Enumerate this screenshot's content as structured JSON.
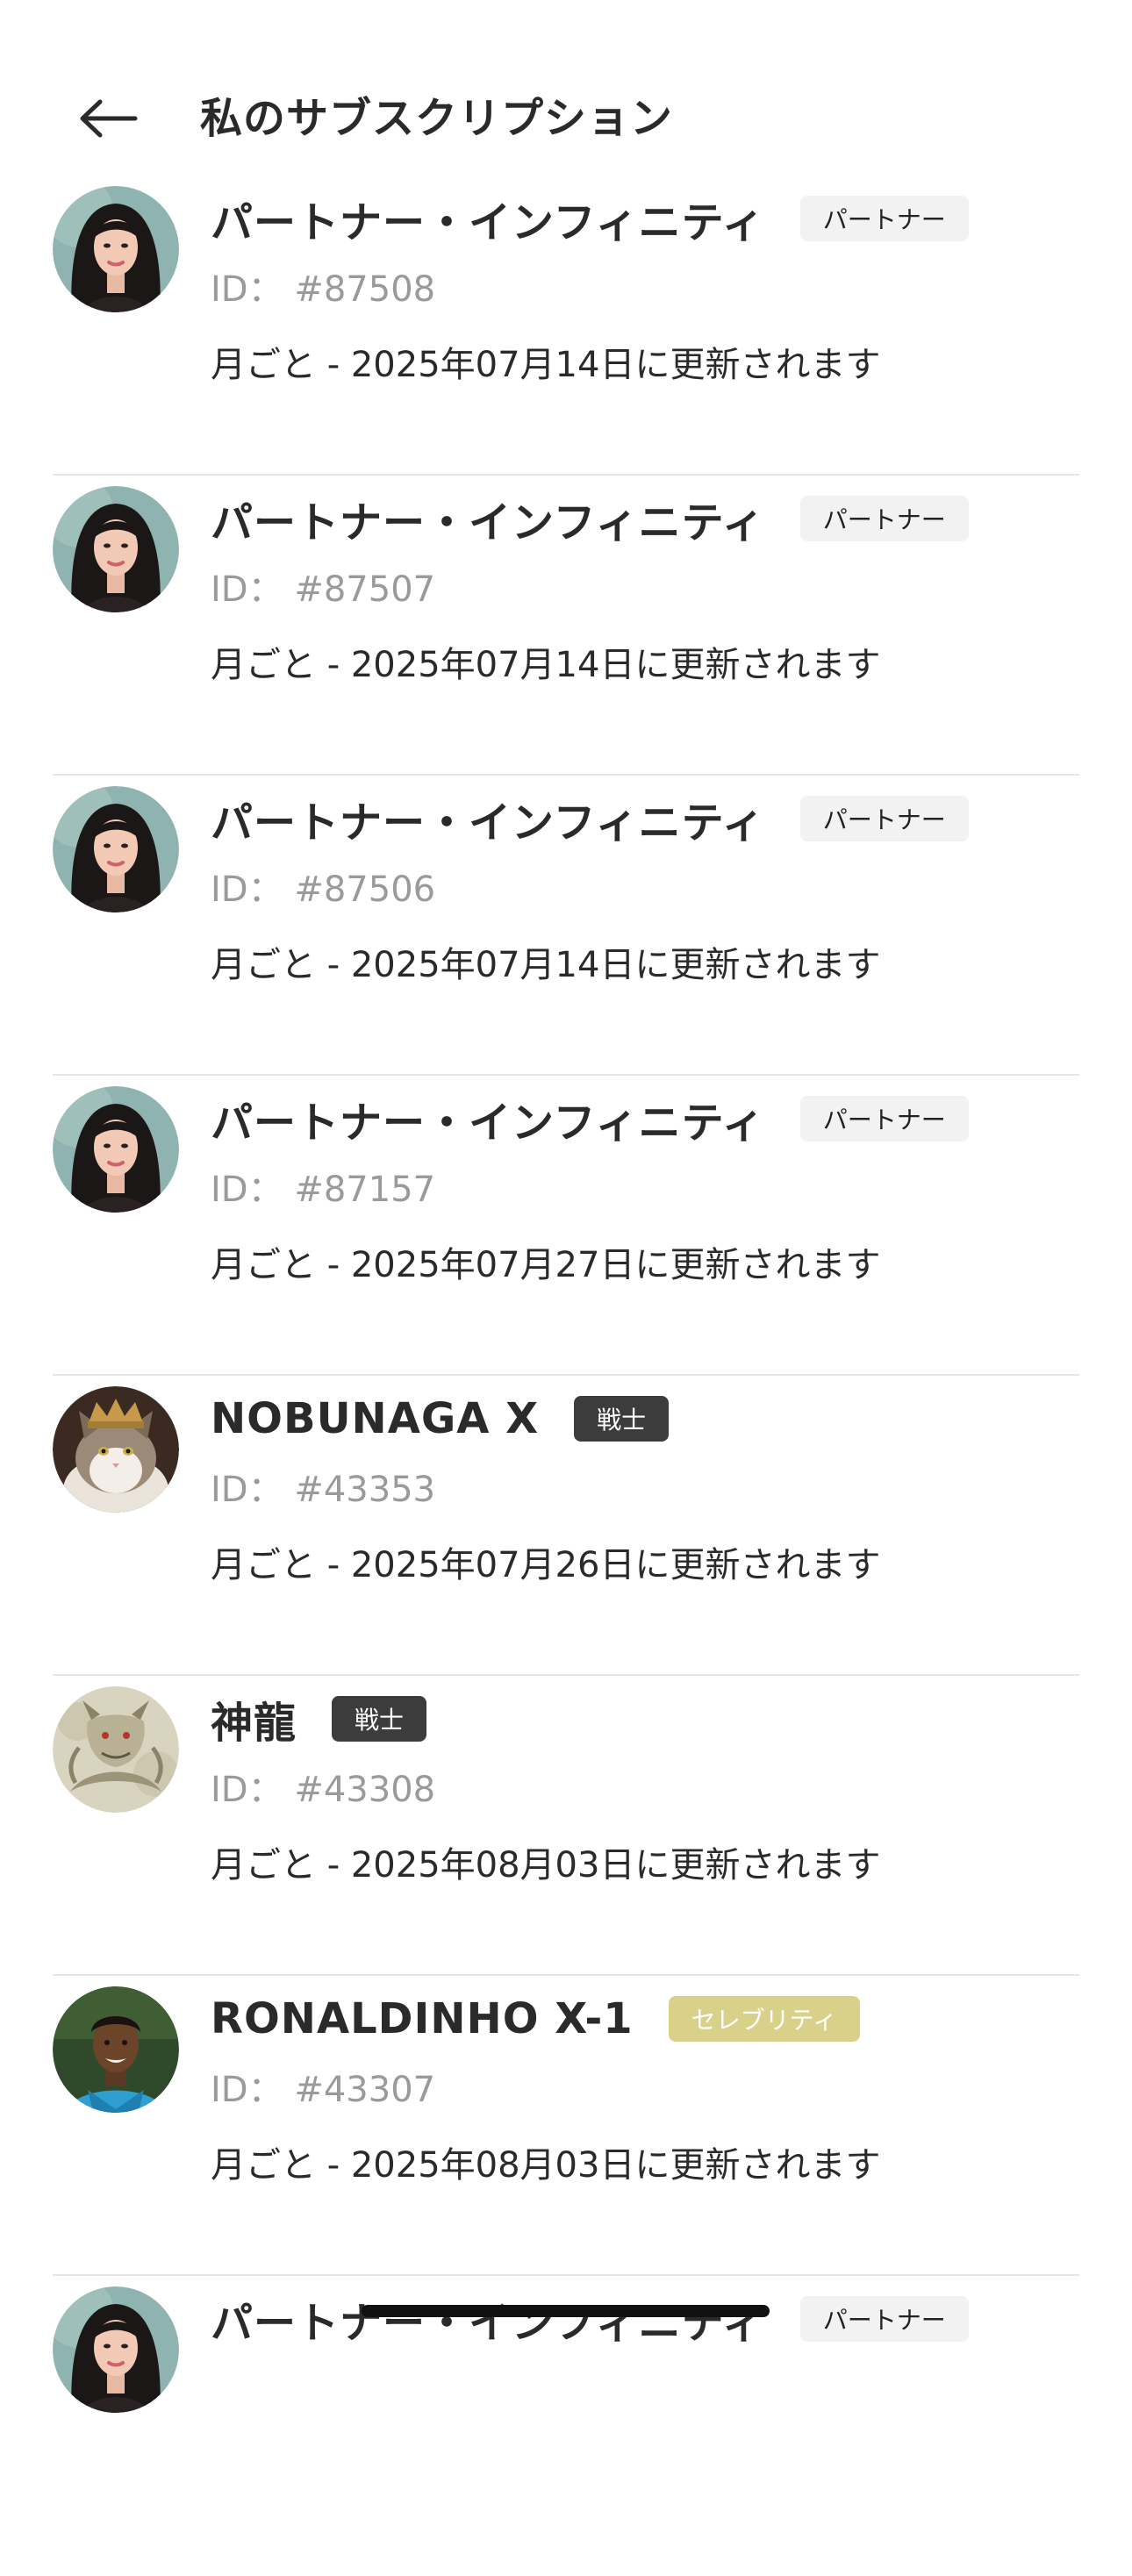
{
  "header": {
    "title": "私のサブスクリプション",
    "back_icon": "arrow-left-icon"
  },
  "colors": {
    "badge_partner_bg": "#f2f2f2",
    "badge_warrior_bg": "#3c3c3c",
    "badge_celebrity_bg": "#d9d18a",
    "divider": "#e6e6e6"
  },
  "subscriptions": [
    {
      "name": "パートナー・インフィニティ",
      "badge": "パートナー",
      "badge_type": "partner",
      "id_label": "ID：",
      "id_value": "#87508",
      "renewal": "月ごと - 2025年07月14日に更新されます",
      "avatar": "woman-portrait"
    },
    {
      "name": "パートナー・インフィニティ",
      "badge": "パートナー",
      "badge_type": "partner",
      "id_label": "ID：",
      "id_value": "#87507",
      "renewal": "月ごと - 2025年07月14日に更新されます",
      "avatar": "woman-portrait"
    },
    {
      "name": "パートナー・インフィニティ",
      "badge": "パートナー",
      "badge_type": "partner",
      "id_label": "ID：",
      "id_value": "#87506",
      "renewal": "月ごと - 2025年07月14日に更新されます",
      "avatar": "woman-portrait"
    },
    {
      "name": "パートナー・インフィニティ",
      "badge": "パートナー",
      "badge_type": "partner",
      "id_label": "ID：",
      "id_value": "#87157",
      "renewal": "月ごと - 2025年07月27日に更新されます",
      "avatar": "woman-portrait"
    },
    {
      "name": "NOBUNAGA X",
      "badge": "戦士",
      "badge_type": "warrior",
      "id_label": "ID：",
      "id_value": "#43353",
      "renewal": "月ごと - 2025年07月26日に更新されます",
      "avatar": "crowned-cat"
    },
    {
      "name": "神龍",
      "badge": "戦士",
      "badge_type": "warrior",
      "id_label": "ID：",
      "id_value": "#43308",
      "renewal": "月ごと - 2025年08月03日に更新されます",
      "avatar": "dragon"
    },
    {
      "name": "RONALDINHO X-1",
      "badge": "セレブリティ",
      "badge_type": "celebrity",
      "id_label": "ID：",
      "id_value": "#43307",
      "renewal": "月ごと - 2025年08月03日に更新されます",
      "avatar": "man-portrait"
    },
    {
      "name": "パートナー・インフィニティ",
      "badge": "パートナー",
      "badge_type": "partner",
      "id_label": "",
      "id_value": "",
      "renewal": "",
      "avatar": "woman-portrait"
    }
  ]
}
